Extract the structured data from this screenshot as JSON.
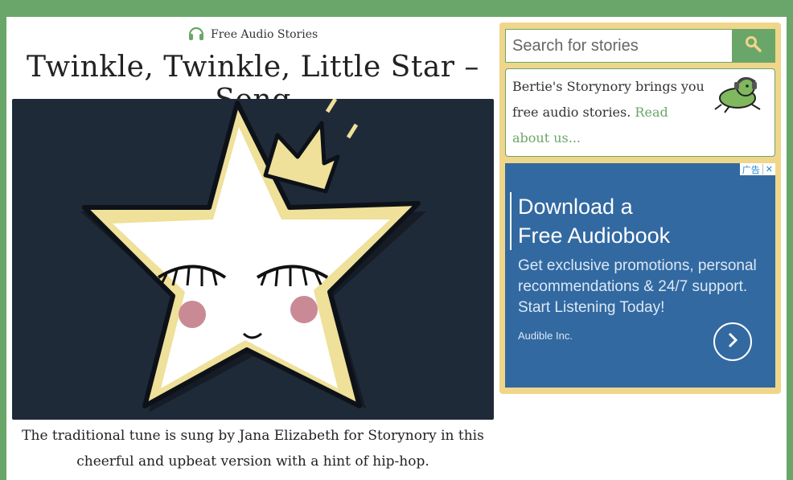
{
  "header": {
    "kicker_label": "Free Audio Stories",
    "kicker_icon": "headphones-icon",
    "title": "Twinkle, Twinkle, Little Star – Song"
  },
  "hero": {
    "description": "Cartoon star with a crown and closed eyes"
  },
  "caption": "The traditional tune is sung by Jana Elizabeth for Storynory in this cheerful and upbeat version with a hint of hip-hop.",
  "sidebar": {
    "search": {
      "placeholder": "Search for stories",
      "button_icon": "search-icon"
    },
    "about": {
      "text": "Bertie's Storynory brings you free audio stories.",
      "link": "Read about us..."
    },
    "ad": {
      "badge": "广告",
      "close": "✕",
      "headline_1": "Download a",
      "headline_2": "Free Audiobook",
      "body": "Get exclusive promotions, personal recommendations & 24/7 support. Start Listening Today!",
      "company": "Audible Inc."
    }
  },
  "colors": {
    "brand_green": "#6aa669",
    "sidebar_yellow": "#efd68a",
    "ad_blue": "#3269a1",
    "hero_bg": "#1f2a39"
  }
}
